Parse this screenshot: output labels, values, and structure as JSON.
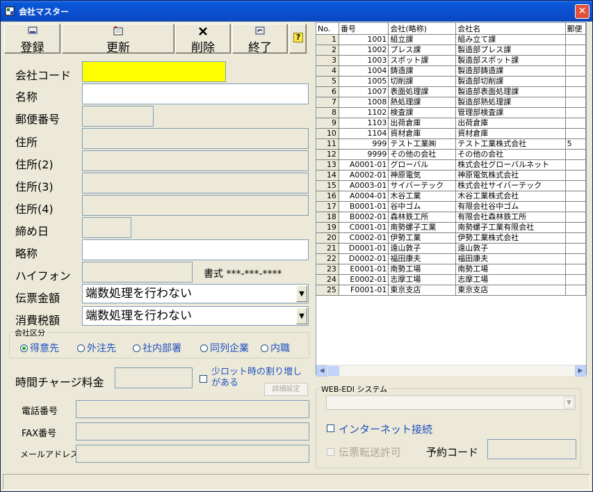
{
  "window": {
    "title": "会社マスター",
    "close_glyph": "✕"
  },
  "toolbar": {
    "register_label": "登録",
    "update_label": "更新",
    "delete_label": "削除",
    "exit_label": "終了",
    "help_glyph": "?"
  },
  "form": {
    "company_code_label": "会社コード",
    "name_label": "名称",
    "postal_label": "郵便番号",
    "address_label": "住所",
    "address2_label": "住所(2)",
    "address3_label": "住所(3)",
    "address4_label": "住所(4)",
    "closing_day_label": "締め日",
    "abbrev_label": "略称",
    "hyphen_label": "ハイフォン",
    "format_label": "書式 ***-***-****",
    "slip_amount_label": "伝票金額",
    "slip_amount_value": "端数処理を行わない",
    "tax_amount_label": "消費税額",
    "tax_amount_value": "端数処理を行わない",
    "company_type_group": "会社区分",
    "company_types": [
      "得意先",
      "外注先",
      "社内部署",
      "同列企業",
      "内職"
    ],
    "company_type_selected": 0,
    "hourly_charge_label": "時間チャージ料金",
    "small_lot_label_1": "少ロット時の割り増し",
    "small_lot_label_2": "がある",
    "detail_settings_label": "詳細設定",
    "phone_label": "電話番号",
    "fax_label": "FAX番号",
    "email_label": "メールアドレス"
  },
  "webedi": {
    "group_title": "WEB-EDI システム",
    "internet_label": "インターネット接続",
    "slip_transfer_label": "伝票転送許可",
    "reservation_code_label": "予約コード"
  },
  "grid": {
    "columns": [
      "No.",
      "番号",
      "会社(略称)",
      "会社名",
      "郵便"
    ],
    "rows": [
      [
        "1",
        "1001",
        "組立課",
        "組み立て課",
        ""
      ],
      [
        "2",
        "1002",
        "プレス課",
        "製造部プレス課",
        ""
      ],
      [
        "3",
        "1003",
        "スポット課",
        "製造部スポット課",
        ""
      ],
      [
        "4",
        "1004",
        "鋳造課",
        "製造部鋳造課",
        ""
      ],
      [
        "5",
        "1005",
        "切削課",
        "製造部切削課",
        ""
      ],
      [
        "6",
        "1007",
        "表面処理課",
        "製造部表面処理課",
        ""
      ],
      [
        "7",
        "1008",
        "熱処理課",
        "製造部熱処理課",
        ""
      ],
      [
        "8",
        "1102",
        "検査課",
        "管理部検査課",
        ""
      ],
      [
        "9",
        "1103",
        "出荷倉庫",
        "出荷倉庫",
        ""
      ],
      [
        "10",
        "1104",
        "資材倉庫",
        "資材倉庫",
        ""
      ],
      [
        "11",
        "999",
        "テスト工業㈱",
        "テスト工業株式会社",
        "5"
      ],
      [
        "12",
        "9999",
        "その他の会社",
        "その他の会社",
        ""
      ],
      [
        "13",
        "A0001-01",
        "グローバル",
        "株式会社グローバルネット",
        ""
      ],
      [
        "14",
        "A0002-01",
        "神原電気",
        "神原電気株式会社",
        ""
      ],
      [
        "15",
        "A0003-01",
        "サイバーテック",
        "株式会社サイバーテック",
        ""
      ],
      [
        "16",
        "A0004-01",
        "木谷工業",
        "木谷工業株式会社",
        ""
      ],
      [
        "17",
        "B0001-01",
        "谷中ゴム",
        "有限会社谷中ゴム",
        ""
      ],
      [
        "18",
        "B0002-01",
        "森林鉄工所",
        "有限会社森林鉄工所",
        ""
      ],
      [
        "19",
        "C0001-01",
        "南勢螺子工業",
        "南勢螺子工業有限会社",
        ""
      ],
      [
        "20",
        "C0002-01",
        "伊勢工業",
        "伊勢工業株式会社",
        ""
      ],
      [
        "21",
        "D0001-01",
        "遠山敦子",
        "遠山敦子",
        ""
      ],
      [
        "22",
        "D0002-01",
        "福田康夫",
        "福田康夫",
        ""
      ],
      [
        "23",
        "E0001-01",
        "南勢工場",
        "南勢工場",
        ""
      ],
      [
        "24",
        "E0002-01",
        "志摩工場",
        "志摩工場",
        ""
      ],
      [
        "25",
        "F0001-01",
        "東京支店",
        "東京支店",
        ""
      ]
    ]
  },
  "colors": {
    "titlebar": "#0a58d8",
    "company_code_bg": "#ffff00",
    "radio_text": "#2050c0"
  }
}
